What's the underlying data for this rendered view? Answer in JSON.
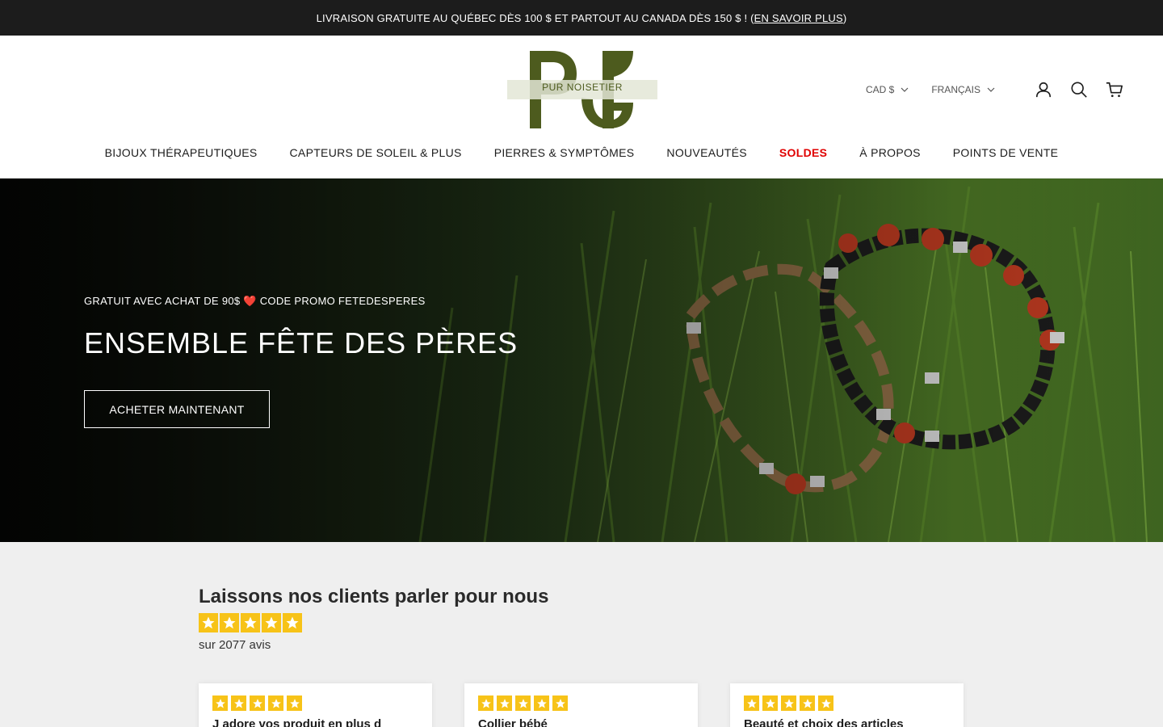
{
  "announcement": {
    "text": "LIVRAISON GRATUITE AU QUÉBEC DÈS 100 $ ET PARTOUT AU CANADA DÈS 150 $ ! (",
    "link": "EN SAVOIR PLUS",
    "suffix": ")"
  },
  "logo": {
    "text": "PUR NOISETIER",
    "color": "#4d5b1e"
  },
  "header": {
    "currency": "CAD $",
    "language": "FRANÇAIS",
    "icons": [
      "account-icon",
      "search-icon",
      "cart-icon"
    ]
  },
  "nav": {
    "items": [
      {
        "label": "BIJOUX THÉRAPEUTIQUES"
      },
      {
        "label": "CAPTEURS DE SOLEIL & PLUS"
      },
      {
        "label": "PIERRES & SYMPTÔMES"
      },
      {
        "label": "NOUVEAUTÉS"
      },
      {
        "label": "SOLDES"
      },
      {
        "label": "À PROPOS"
      },
      {
        "label": "POINTS DE VENTE"
      }
    ],
    "sale_color": "#e00000"
  },
  "hero": {
    "subtitle": "GRATUIT AVEC ACHAT DE 90$ ❤️ CODE PROMO FETEDESPERES",
    "title": "ENSEMBLE FÊTE DES PÈRES",
    "button": "ACHETER MAINTENANT"
  },
  "reviews": {
    "title": "Laissons nos clients parler pour nous",
    "rating": 5,
    "count_text": "sur 2077 avis",
    "star_color": "#f7c318",
    "cards": [
      {
        "title": "J adore vos produit en plus d",
        "rating": 5
      },
      {
        "title": "Collier bébé",
        "rating": 5
      },
      {
        "title": "Beauté et choix des articles",
        "rating": 5
      }
    ]
  }
}
